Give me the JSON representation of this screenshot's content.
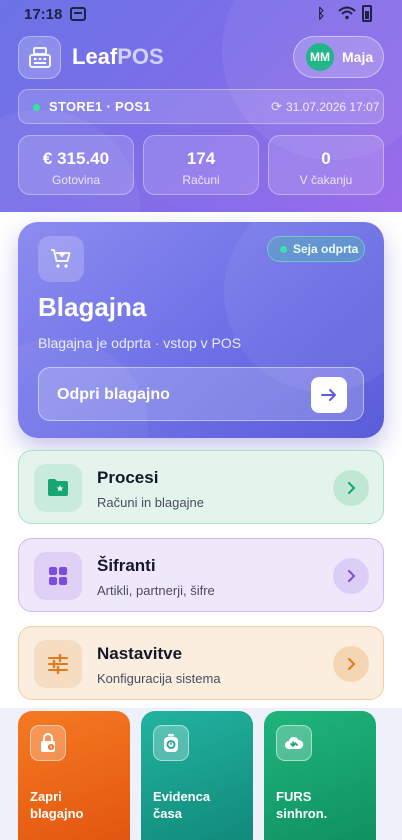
{
  "status_bar": {
    "time": "17:18"
  },
  "header": {
    "app_name_part1": "Leaf",
    "app_name_part2": "POS",
    "user": {
      "initials": "MM",
      "name": "Maja"
    },
    "store": {
      "label": "STORE1 · POS1",
      "datetime": "31.07.2026 17:07"
    },
    "stats": [
      {
        "value": "€ 315.40",
        "label": "Gotovina"
      },
      {
        "value": "174",
        "label": "Računi"
      },
      {
        "value": "0",
        "label": "V čakanju"
      }
    ]
  },
  "hero": {
    "badge": "Seja odprta",
    "title": "Blagajna",
    "subtitle": "Blagajna je odprta · vstop v POS",
    "button_label": "Odpri blagajno"
  },
  "menu": [
    {
      "title": "Procesi",
      "subtitle": "Računi in blagajne",
      "icon": "folder-star-icon",
      "accent": "#17a673"
    },
    {
      "title": "Šifranti",
      "subtitle": "Artikli, partnerji, šifre",
      "icon": "grid-icon",
      "accent": "#7a4de0"
    },
    {
      "title": "Nastavitve",
      "subtitle": "Konfiguracija sistema",
      "icon": "sliders-icon",
      "accent": "#e07a1f"
    }
  ],
  "tiles": [
    {
      "label": "Zapri\nblagajno",
      "icon": "lock-icon",
      "color": "#f06d1a"
    },
    {
      "label": "Evidenca\nčasa",
      "icon": "timer-icon",
      "color": "#1aa390"
    },
    {
      "label": "FURS\nsinhron.",
      "icon": "cloud-sync-icon",
      "color": "#1aa672"
    }
  ]
}
